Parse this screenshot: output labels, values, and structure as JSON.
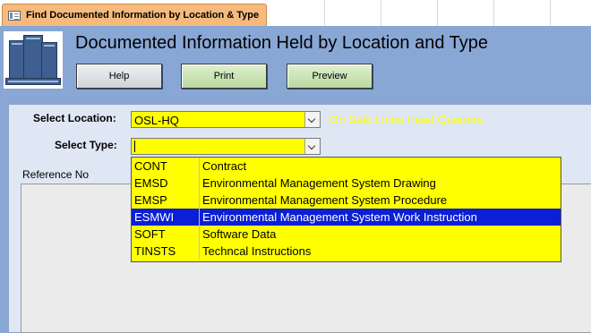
{
  "tab": {
    "label": "Find Documented Information by Location & Type",
    "icon": "form-icon"
  },
  "header": {
    "title": "Documented Information Held by Location and Type",
    "logo_icon": "file-cabinet-logo",
    "buttons": {
      "help": "Help",
      "print": "Print",
      "preview": "Preview"
    }
  },
  "form": {
    "location": {
      "label": "Select Location:",
      "value": "OSL-HQ",
      "description": "On Safe Lines Head Quarters"
    },
    "type": {
      "label": "Select Type:",
      "value": ""
    },
    "reference_header": "Reference No"
  },
  "dropdown": {
    "selected_index": 3,
    "items": [
      {
        "code": "CONT",
        "description": "Contract"
      },
      {
        "code": "EMSD",
        "description": "Environmental Management System Drawing"
      },
      {
        "code": "EMSP",
        "description": "Environmental Management System Procedure"
      },
      {
        "code": "ESMWI",
        "description": "Environmental Management System Work Instruction"
      },
      {
        "code": "SOFT",
        "description": "Software Data"
      },
      {
        "code": "TINSTS",
        "description": "Techncal Instructions"
      }
    ]
  },
  "colors": {
    "header_bg": "#89a7d5",
    "panel_bg": "#dfe7f5",
    "tab_bg": "#f6ba7c",
    "field_bg": "#ffff00",
    "selection_bg": "#0b1fd6",
    "location_desc_color": "#ffff00"
  }
}
